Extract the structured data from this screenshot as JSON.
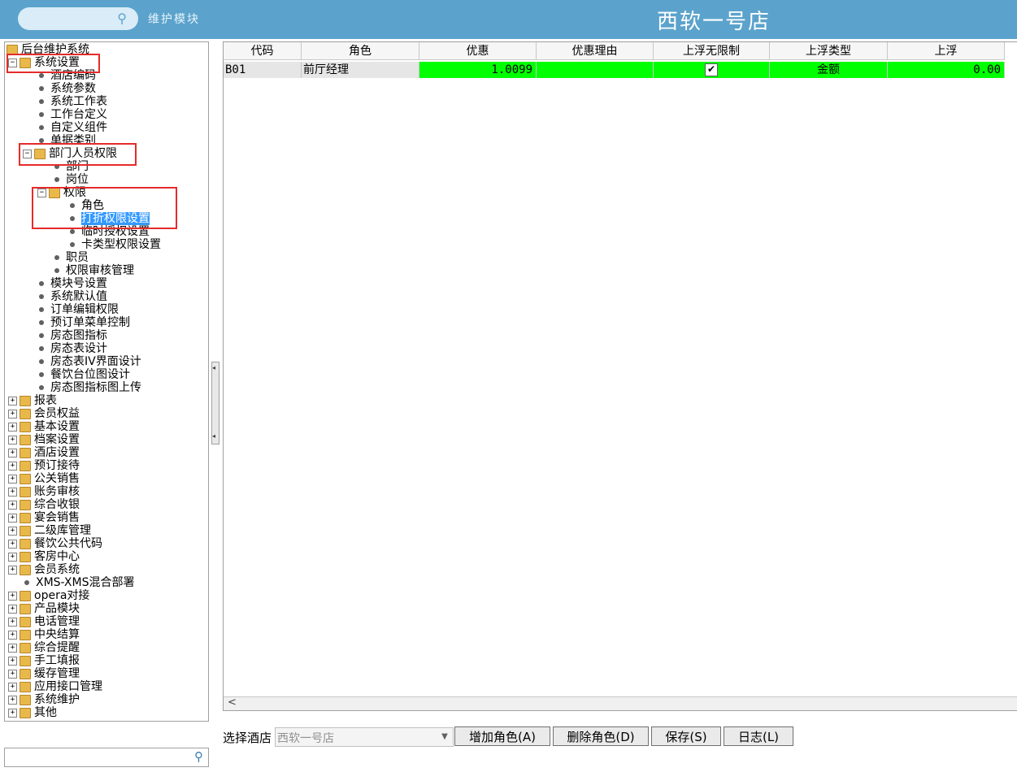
{
  "header": {
    "module_label": "维护模块",
    "hotel_name": "西软一号店"
  },
  "tree": {
    "root": "后台维护系统",
    "system_settings": "系统设置",
    "sys_children_1": [
      "酒店编码",
      "系统参数",
      "系统工作表",
      "工作台定义",
      "自定义组件",
      "单据类别"
    ],
    "dept_perm": "部门人员权限",
    "dept_children": [
      "部门",
      "岗位"
    ],
    "perm": "权限",
    "perm_children": [
      "角色",
      "打折权限设置",
      "临时授权设置",
      "卡类型权限设置"
    ],
    "dept_children_2": [
      "职员",
      "权限审核管理"
    ],
    "sys_children_2": [
      "模块号设置",
      "系统默认值",
      "订单编辑权限",
      "预订单菜单控制",
      "房态图指标",
      "房态表设计",
      "房态表IV界面设计",
      "餐饮台位图设计",
      "房态图指标图上传"
    ],
    "top_items_1": [
      "报表",
      "会员权益",
      "基本设置",
      "档案设置",
      "酒店设置",
      "预订接待",
      "公关销售",
      "账务审核",
      "综合收银",
      "宴会销售",
      "二级库管理",
      "餐饮公共代码",
      "客房中心",
      "会员系统"
    ],
    "leaf_item": "XMS-XMS混合部署",
    "top_items_2": [
      "opera对接",
      "产品模块",
      "电话管理",
      "中央结算",
      "综合提醒",
      "手工填报",
      "缓存管理",
      "应用接口管理",
      "系统维护",
      "其他"
    ]
  },
  "grid": {
    "columns": [
      "代码",
      "角色",
      "优惠",
      "优惠理由",
      "上浮无限制",
      "上浮类型",
      "上浮"
    ],
    "rows": [
      {
        "code": "B01",
        "role": "前厅经理",
        "discount": "1.0099",
        "reason": "",
        "unlimited": true,
        "type": "金额",
        "float": "0.00"
      }
    ]
  },
  "footer": {
    "hotel_label": "选择酒店",
    "hotel_value": "西软一号店",
    "buttons": [
      "增加角色(A)",
      "删除角色(D)",
      "保存(S)",
      "日志(L)"
    ]
  },
  "colors": {
    "header_bg": "#5ba3cc",
    "row_highlight": "#00ff00",
    "selection": "#3399ff",
    "annotation_box": "#e52b2b"
  }
}
